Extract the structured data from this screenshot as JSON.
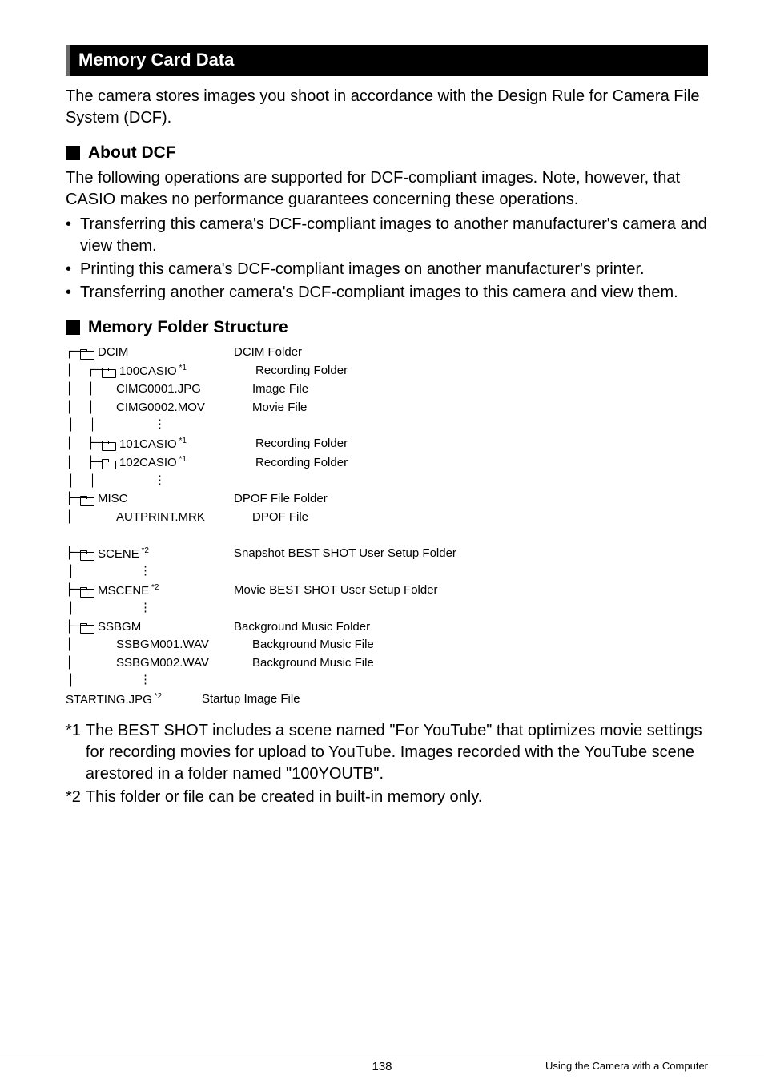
{
  "header": {
    "title": "Memory Card Data"
  },
  "intro": "The camera stores images you shoot in accordance with the Design Rule for Camera File System (DCF).",
  "aboutDcf": {
    "heading": "About DCF",
    "lead": "The following operations are supported for DCF-compliant images. Note, however, that CASIO makes no performance guarantees concerning these operations.",
    "bullets": [
      "Transferring this camera's DCF-compliant images to another manufacturer's camera and view them.",
      "Printing this camera's DCF-compliant images on another manufacturer's printer.",
      "Transferring another camera's DCF-compliant images to this camera and view them."
    ]
  },
  "folderStruct": {
    "heading": "Memory Folder Structure",
    "rows": [
      {
        "lines": "┌─",
        "icon": true,
        "name": "DCIM",
        "sup": "",
        "desc": "DCIM Folder"
      },
      {
        "lines": "│  ┌─",
        "icon": true,
        "name": "100CASIO",
        "sup": "*1",
        "desc": "Recording Folder"
      },
      {
        "lines": "│  │   ",
        "icon": false,
        "name": "CIMG0001.JPG",
        "sup": "",
        "desc": "Image File"
      },
      {
        "lines": "│  │   ",
        "icon": false,
        "name": "CIMG0002.MOV",
        "sup": "",
        "desc": "Movie File"
      },
      {
        "vdots": "│  │        ⋮"
      },
      {
        "lines": "│  ├─",
        "icon": true,
        "name": "101CASIO",
        "sup": "*1",
        "desc": "Recording Folder"
      },
      {
        "lines": "│  ├─",
        "icon": true,
        "name": "102CASIO",
        "sup": "*1",
        "desc": "Recording Folder"
      },
      {
        "vdots": "│  │        ⋮"
      },
      {
        "lines": "├─",
        "icon": true,
        "name": "MISC",
        "sup": "",
        "desc": "DPOF File Folder"
      },
      {
        "lines": "│      ",
        "icon": false,
        "name": "AUTPRINT.MRK",
        "sup": "",
        "desc": "DPOF File"
      },
      {
        "blank": true
      },
      {
        "lines": "├─",
        "icon": true,
        "name": "SCENE",
        "sup": "*2",
        "desc": "Snapshot BEST SHOT User Setup Folder"
      },
      {
        "vdots": "│         ⋮"
      },
      {
        "lines": "├─",
        "icon": true,
        "name": "MSCENE",
        "sup": "*2",
        "desc": "Movie BEST SHOT User Setup Folder"
      },
      {
        "vdots": "│         ⋮"
      },
      {
        "lines": "├─",
        "icon": true,
        "name": "SSBGM",
        "sup": "",
        "desc": "Background Music Folder"
      },
      {
        "lines": "│      ",
        "icon": false,
        "name": "SSBGM001.WAV",
        "sup": "",
        "desc": "Background Music File"
      },
      {
        "lines": "│      ",
        "icon": false,
        "name": "SSBGM002.WAV",
        "sup": "",
        "desc": "Background Music File"
      },
      {
        "vdots": "│         ⋮"
      },
      {
        "lines": "",
        "icon": false,
        "name": "STARTING.JPG",
        "sup": "*2",
        "desc": "Startup Image File"
      }
    ]
  },
  "footnotes": [
    {
      "mark": "*1",
      "text": "The BEST SHOT includes a scene named \"For YouTube\" that optimizes movie settings for recording movies for upload to YouTube. Images recorded with the YouTube scene arestored in a folder named \"100YOUTB\"."
    },
    {
      "mark": "*2",
      "text": "This folder or file can be created in built-in memory only."
    }
  ],
  "footer": {
    "page": "138",
    "section": "Using the Camera with a Computer"
  }
}
